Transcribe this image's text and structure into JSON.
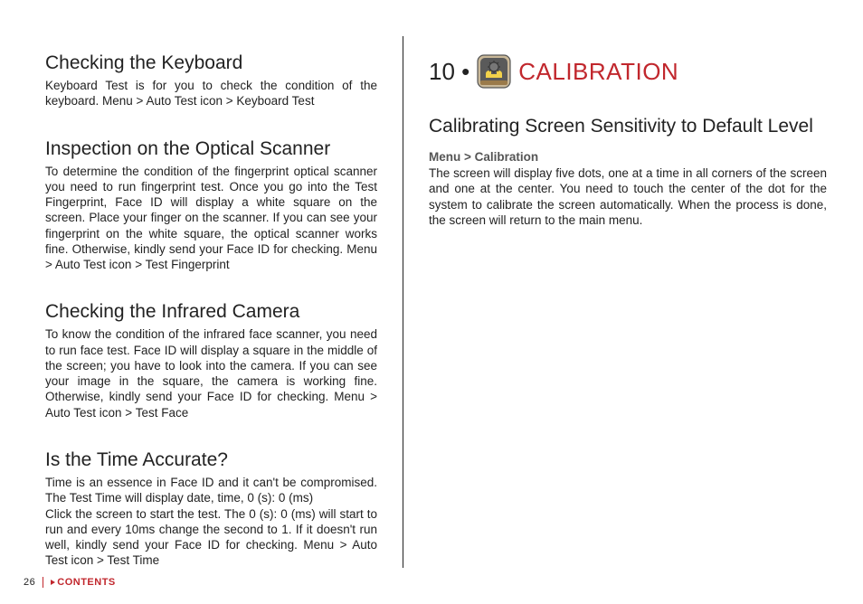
{
  "left": {
    "s1": {
      "title": "Checking the Keyboard",
      "body": "Keyboard Test is for you to check the condition of the keyboard. Menu > Auto Test icon > Keyboard Test"
    },
    "s2": {
      "title": "Inspection on the Optical Scanner",
      "body": "To determine the condition of the fingerprint optical scanner you need to run fingerprint test. Once you go into the Test Fingerprint, Face ID will display a white square on the screen. Place your finger on the scanner. If you can see your fingerprint on the white square, the optical scanner works fine. Otherwise, kindly send your Face ID for checking. Menu > Auto Test icon > Test Fingerprint"
    },
    "s3": {
      "title": "Checking the Infrared Camera",
      "body": "To know the condition of the infrared face scanner, you need to run face test. Face ID will display a square in the middle of the screen; you have to look into the camera. If you can see your image in the square, the camera is working fine. Otherwise, kindly send your Face ID for checking. Menu > Auto Test icon > Test Face"
    },
    "s4": {
      "title": "Is the Time Accurate?",
      "body": "Time is an essence in Face ID and it can't be compromised. The Test Time will display date, time, 0 (s): 0 (ms)\nClick the screen to start the test. The 0 (s): 0 (ms) will start to run and every 10ms change the second to 1. If it doesn't run well, kindly send your Face ID for checking. Menu > Auto Test icon > Test Time"
    }
  },
  "right": {
    "chapter_num": "10 •",
    "chapter_title": "CALIBRATION",
    "s1": {
      "title": "Calibrating Screen Sensitivity to Default Level",
      "menu": "Menu > Calibration",
      "body": "The screen will display five dots, one at a time in all corners of the screen and one at the center. You need to touch the center of the dot for the system to calibrate the screen automatically. When the process is done, the screen will return to the main menu."
    }
  },
  "footer": {
    "page": "26",
    "contents": "CONTENTS"
  }
}
